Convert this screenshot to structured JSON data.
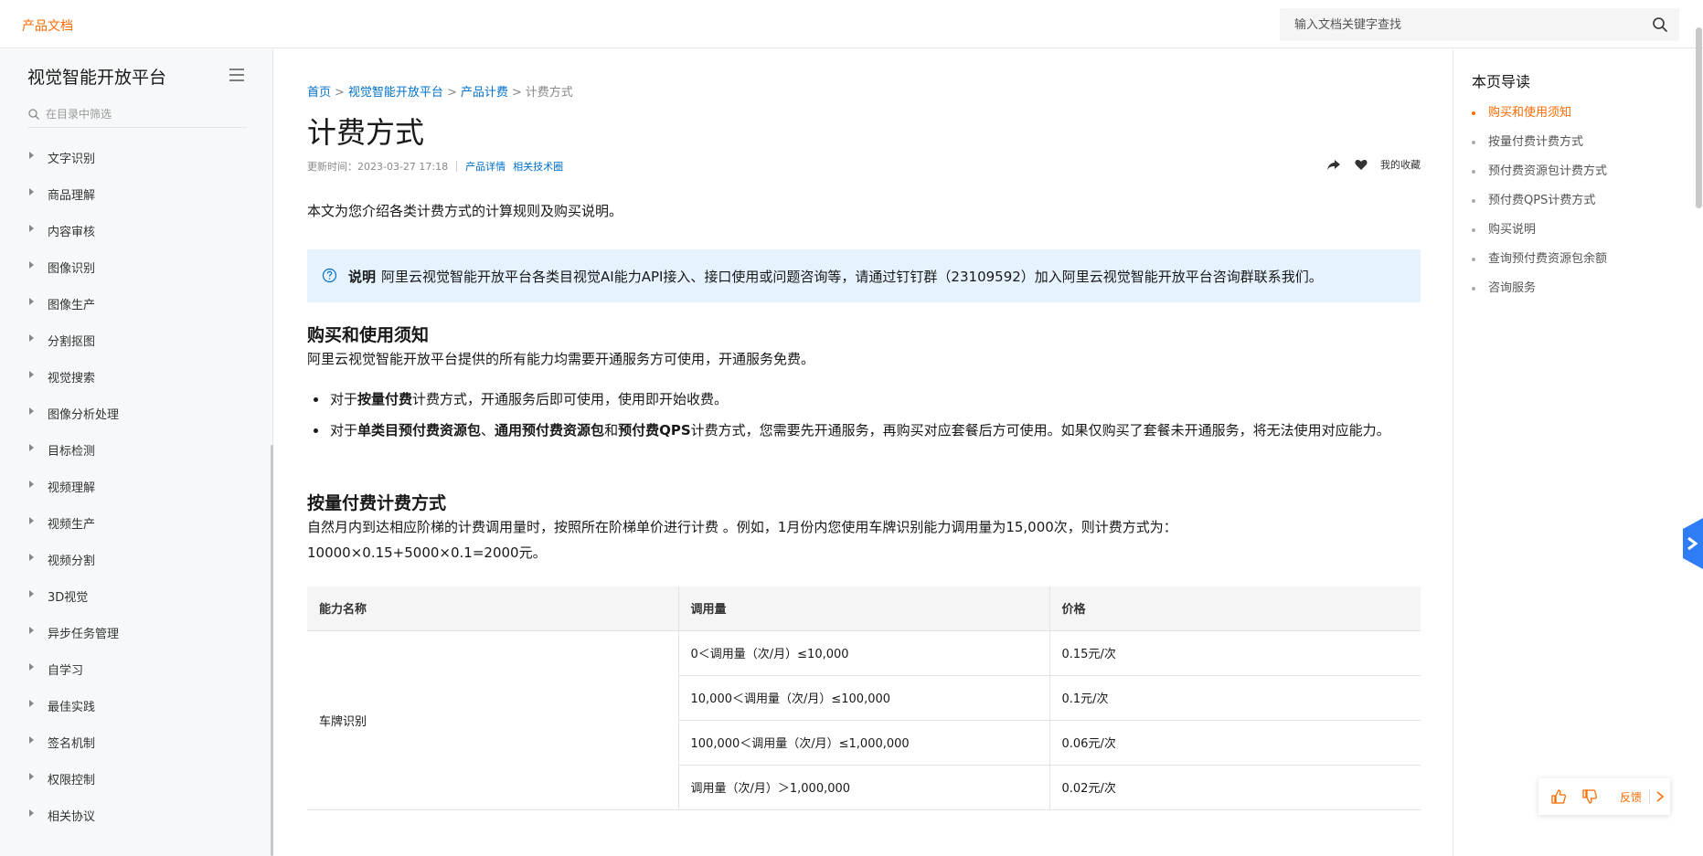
{
  "header": {
    "brand": "产品文档",
    "search_placeholder": "输入文档关键字查找"
  },
  "sidebar": {
    "title": "视觉智能开放平台",
    "filter_placeholder": "在目录中筛选",
    "items": [
      {
        "label": "文字识别"
      },
      {
        "label": "商品理解"
      },
      {
        "label": "内容审核"
      },
      {
        "label": "图像识别"
      },
      {
        "label": "图像生产"
      },
      {
        "label": "分割抠图"
      },
      {
        "label": "视觉搜索"
      },
      {
        "label": "图像分析处理"
      },
      {
        "label": "目标检测"
      },
      {
        "label": "视频理解"
      },
      {
        "label": "视频生产"
      },
      {
        "label": "视频分割"
      },
      {
        "label": "3D视觉"
      },
      {
        "label": "异步任务管理"
      },
      {
        "label": "自学习"
      },
      {
        "label": "最佳实践"
      },
      {
        "label": "签名机制"
      },
      {
        "label": "权限控制"
      },
      {
        "label": "相关协议"
      }
    ]
  },
  "breadcrumb": {
    "items": [
      "首页",
      "视觉智能开放平台",
      "产品计费"
    ],
    "current": "计费方式",
    "separator": ">"
  },
  "article": {
    "title": "计费方式",
    "updated": "更新时间：2023-03-27 17:18",
    "link_product": "产品详情",
    "link_community": "相关技术圈",
    "favorite_label": "我的收藏",
    "intro": "本文为您介绍各类计费方式的计算规则及购买说明。",
    "note_label": "说明",
    "note_text": "阿里云视觉智能开放平台各类目视觉AI能力API接入、接口使用或问题咨询等，请通过钉钉群（23109592）加入阿里云视觉智能开放平台咨询群联系我们。",
    "section1": {
      "heading": "购买和使用须知",
      "para": "阿里云视觉智能开放平台提供的所有能力均需要开通服务方可使用，开通服务免费。",
      "bullet1": {
        "pre": "对于",
        "bold": "按量付费",
        "post": "计费方式，开通服务后即可使用，使用即开始收费。"
      },
      "bullet2": {
        "pre": "对于",
        "bold1": "单类目预付费资源包",
        "mid1": "、",
        "bold2": "通用预付费资源包",
        "mid2": "和",
        "bold3": "预付费QPS",
        "post": "计费方式，您需要先开通服务，再购买对应套餐后方可使用。如果仅购买了套餐未开通服务，将无法使用对应能力。"
      }
    },
    "section2": {
      "heading": "按量付费计费方式",
      "para1": "自然月内到达相应阶梯的计费调用量时，按照所在阶梯单价进行计费 。例如，1月份内您使用车牌识别能力调用量为15,000次，则计费方式为：",
      "para2": "10000×0.15+5000×0.1=2000元。"
    },
    "table": {
      "headers": [
        "能力名称",
        "调用量",
        "价格"
      ],
      "ability": "车牌识别",
      "rows": [
        {
          "volume": "0＜调用量（次/月）≤10,000",
          "price": "0.15元/次"
        },
        {
          "volume": "10,000＜调用量（次/月）≤100,000",
          "price": "0.1元/次"
        },
        {
          "volume": "100,000＜调用量（次/月）≤1,000,000",
          "price": "0.06元/次"
        },
        {
          "volume": "调用量（次/月）＞1,000,000",
          "price": "0.02元/次"
        }
      ]
    }
  },
  "toc": {
    "title": "本页导读",
    "items": [
      {
        "label": "购买和使用须知"
      },
      {
        "label": "按量付费计费方式"
      },
      {
        "label": "预付费资源包计费方式"
      },
      {
        "label": "预付费QPS计费方式"
      },
      {
        "label": "购买说明"
      },
      {
        "label": "查询预付费资源包余额"
      },
      {
        "label": "咨询服务"
      }
    ]
  },
  "feedback": {
    "label": "反馈"
  },
  "colors": {
    "accent": "#ff6a00",
    "link": "#0070cc",
    "note_bg": "#e6f3ff"
  }
}
